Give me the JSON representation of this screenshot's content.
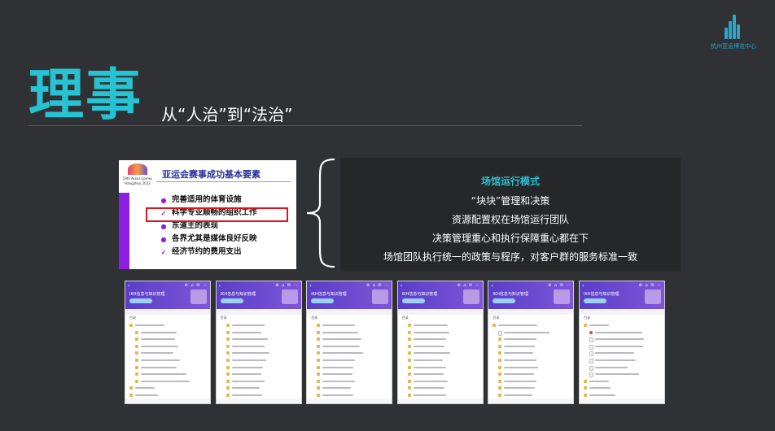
{
  "logo": {
    "name": "杭州亚运博览中心"
  },
  "header": {
    "title": "理事",
    "subtitle": "从“人治”到“法治”"
  },
  "slide_card": {
    "logo_line1": "19th Asian Games",
    "logo_line2": "Hangzhou 2022",
    "title": "亚运会赛事成功基本要素",
    "items": [
      {
        "marker": "●",
        "text": "完善适用的体育设施"
      },
      {
        "marker": "✓",
        "text": "科学专业顺畅的组织工作"
      },
      {
        "marker": "●",
        "text": "东道主的表现"
      },
      {
        "marker": "●",
        "text": "各界尤其是媒体良好反映"
      },
      {
        "marker": "✓",
        "text": "经济节约的费用支出"
      }
    ]
  },
  "info_box": {
    "heading": "场馆运行模式",
    "lines": [
      "“块块”管理和决策",
      "资源配置权在场馆运行团队",
      "决策管理重心和执行保障重心都在下",
      "场馆团队执行统一的政策与程序，对客户群的服务标准一致"
    ]
  },
  "phones": {
    "header_title": "IKH信息与知识管理",
    "root_label": "目录",
    "back_glyph": "‹",
    "tool_glyphs": "⊕ ⌂ ✉ ⋯",
    "screens": [
      {
        "rows": [
          {
            "indent": 0,
            "type": "folder",
            "len": 0.45
          },
          {
            "indent": 1,
            "type": "folder",
            "len": 0.55
          },
          {
            "indent": 1,
            "type": "folder",
            "len": 0.52
          },
          {
            "indent": 1,
            "type": "folder",
            "len": 0.58
          },
          {
            "indent": 1,
            "type": "folder",
            "len": 0.5
          },
          {
            "indent": 1,
            "type": "folder",
            "len": 0.6
          },
          {
            "indent": 1,
            "type": "folder",
            "len": 0.55
          },
          {
            "indent": 1,
            "type": "folder",
            "len": 0.7
          },
          {
            "indent": 1,
            "type": "folder",
            "len": 0.75
          },
          {
            "indent": 0,
            "type": "folder",
            "len": 0.3
          },
          {
            "indent": 0,
            "type": "folder",
            "len": 0.35
          },
          {
            "indent": 0,
            "type": "folder",
            "len": 0.4
          }
        ]
      },
      {
        "rows": [
          {
            "indent": 1,
            "type": "folder",
            "len": 0.5
          },
          {
            "indent": 1,
            "type": "folder",
            "len": 0.45
          },
          {
            "indent": 1,
            "type": "folder",
            "len": 0.55
          },
          {
            "indent": 1,
            "type": "folder",
            "len": 0.5
          },
          {
            "indent": 1,
            "type": "folder",
            "len": 0.58
          },
          {
            "indent": 1,
            "type": "folder",
            "len": 0.52
          },
          {
            "indent": 1,
            "type": "folder",
            "len": 0.48
          },
          {
            "indent": 1,
            "type": "folder",
            "len": 0.45
          },
          {
            "indent": 1,
            "type": "folder",
            "len": 0.5
          },
          {
            "indent": 1,
            "type": "folder",
            "len": 0.42
          },
          {
            "indent": 1,
            "type": "folder",
            "len": 0.46
          },
          {
            "indent": 1,
            "type": "folder",
            "len": 0.44
          }
        ]
      },
      {
        "rows": [
          {
            "indent": 1,
            "type": "folder",
            "len": 0.5
          },
          {
            "indent": 1,
            "type": "folder",
            "len": 0.55
          },
          {
            "indent": 1,
            "type": "folder",
            "len": 0.6
          },
          {
            "indent": 1,
            "type": "folder",
            "len": 0.58
          },
          {
            "indent": 1,
            "type": "folder",
            "len": 0.62
          },
          {
            "indent": 1,
            "type": "folder",
            "len": 0.5
          },
          {
            "indent": 1,
            "type": "folder",
            "len": 0.48
          },
          {
            "indent": 1,
            "type": "folder",
            "len": 0.46
          },
          {
            "indent": 1,
            "type": "folder",
            "len": 0.5
          },
          {
            "indent": 1,
            "type": "folder",
            "len": 0.44
          },
          {
            "indent": 1,
            "type": "folder",
            "len": 0.47
          },
          {
            "indent": 1,
            "type": "folder",
            "len": 0.52
          }
        ]
      },
      {
        "rows": [
          {
            "indent": 1,
            "type": "folder",
            "len": 0.52
          },
          {
            "indent": 1,
            "type": "folder",
            "len": 0.55
          },
          {
            "indent": 1,
            "type": "folder",
            "len": 0.5
          },
          {
            "indent": 1,
            "type": "folder",
            "len": 0.48
          },
          {
            "indent": 1,
            "type": "folder",
            "len": 0.56
          },
          {
            "indent": 1,
            "type": "folder",
            "len": 0.45
          },
          {
            "indent": 1,
            "type": "folder",
            "len": 0.5
          },
          {
            "indent": 1,
            "type": "folder",
            "len": 0.46
          },
          {
            "indent": 1,
            "type": "folder",
            "len": 0.52
          },
          {
            "indent": 1,
            "type": "folder",
            "len": 0.48
          },
          {
            "indent": 1,
            "type": "folder",
            "len": 0.5
          },
          {
            "indent": 1,
            "type": "folder",
            "len": 0.46
          }
        ]
      },
      {
        "rows": [
          {
            "indent": 0,
            "type": "folder",
            "len": 0.6
          },
          {
            "indent": 1,
            "type": "doc",
            "len": 0.7
          },
          {
            "indent": 1,
            "type": "folder",
            "len": 0.5
          },
          {
            "indent": 1,
            "type": "folder",
            "len": 0.48
          },
          {
            "indent": 1,
            "type": "folder",
            "len": 0.45
          },
          {
            "indent": 1,
            "type": "folder",
            "len": 0.5
          },
          {
            "indent": 1,
            "type": "folder",
            "len": 0.52
          },
          {
            "indent": 1,
            "type": "folder",
            "len": 0.46
          },
          {
            "indent": 1,
            "type": "folder",
            "len": 0.5
          },
          {
            "indent": 1,
            "type": "folder",
            "len": 0.48
          },
          {
            "indent": 1,
            "type": "folder",
            "len": 0.44
          },
          {
            "indent": 1,
            "type": "folder",
            "len": 0.46
          }
        ]
      },
      {
        "rows": [
          {
            "indent": 0,
            "type": "folder",
            "len": 0.3
          },
          {
            "indent": 1,
            "type": "red",
            "len": 0.72
          },
          {
            "indent": 1,
            "type": "doc",
            "len": 0.75
          },
          {
            "indent": 1,
            "type": "doc",
            "len": 0.74
          },
          {
            "indent": 1,
            "type": "doc",
            "len": 0.6
          },
          {
            "indent": 1,
            "type": "doc",
            "len": 0.62
          },
          {
            "indent": 1,
            "type": "doc",
            "len": 0.5
          },
          {
            "indent": 1,
            "type": "doc",
            "len": 0.68
          },
          {
            "indent": 0,
            "type": "folder",
            "len": 0.3
          },
          {
            "indent": 0,
            "type": "folder",
            "len": 0.32
          },
          {
            "indent": 0,
            "type": "folder",
            "len": 0.4
          }
        ]
      }
    ]
  }
}
